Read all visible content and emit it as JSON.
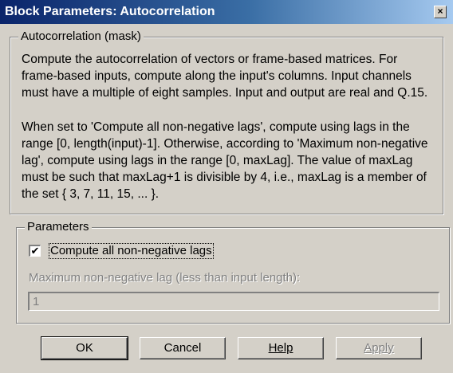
{
  "window": {
    "title": "Block Parameters: Autocorrelation",
    "close_glyph": "×"
  },
  "mask_group": {
    "legend": "Autocorrelation (mask)",
    "paragraph1": [
      "Compute the autocorrelation of vectors or frame-based matrices. For",
      "frame-based inputs, compute along the input's columns. Input channels",
      "must have a multiple of eight samples. Input and output are real and Q.15."
    ],
    "paragraph2": [
      "When set to 'Compute all non-negative lags', compute using lags in the",
      "range [0, length(input)-1]. Otherwise, according to 'Maximum non-negative",
      "lag', compute using lags in the range [0, maxLag].  The value of maxLag",
      "must be such that maxLag+1 is divisible by 4, i.e., maxLag is a member of",
      "the set { 3, 7, 11, 15, ... }."
    ]
  },
  "parameters_group": {
    "legend": "Parameters",
    "checkbox": {
      "label": "Compute all non-negative lags",
      "checked": true,
      "check_glyph": "✔"
    },
    "max_lag": {
      "label": "Maximum non-negative lag (less than input length):",
      "value": "1",
      "enabled": false
    }
  },
  "buttons": {
    "ok": "OK",
    "cancel": "Cancel",
    "help": "Help",
    "apply": "Apply"
  },
  "colors": {
    "dialog_bg": "#d4d0c8",
    "title_gradient_start": "#0a246a",
    "title_gradient_end": "#a6caf0",
    "disabled_text": "#808080"
  }
}
